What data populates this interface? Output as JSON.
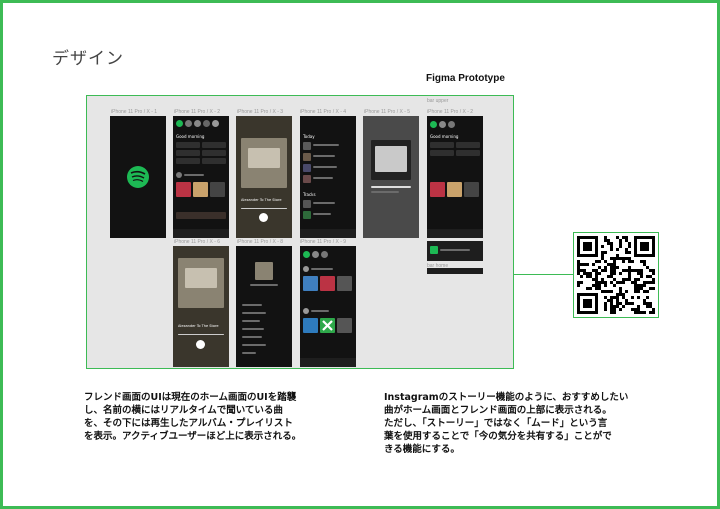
{
  "page": {
    "title": "デザイン",
    "prototype_label": "Figma Prototype",
    "accent_color": "#3dbb55",
    "spotify_green": "#1db954"
  },
  "frames": [
    {
      "label": "iPhone 11 Pro / X - 1"
    },
    {
      "label": "iPhone 11 Pro / X - 2"
    },
    {
      "label": "iPhone 11 Pro / X - 3"
    },
    {
      "label": "iPhone 11 Pro / X - 4"
    },
    {
      "label": "iPhone 11 Pro / X - 5"
    },
    {
      "label": "bar upper"
    },
    {
      "label": "iPhone 11 Pro / X - 6"
    },
    {
      "label": "iPhone 11 Pro / X - 8"
    },
    {
      "label": "iPhone 11 Pro / X - 9"
    },
    {
      "label": "bar home"
    }
  ],
  "phone_text": {
    "good_morning": "Good morning",
    "today": "Today",
    "tracks": "Tracks",
    "now_playing": "Alexander To The Store"
  },
  "qr": {
    "icon": "qr-code-icon"
  },
  "descriptions": {
    "left": "フレンド画面のUIは現在のホーム画面のUIを踏襲\nし、名前の横にはリアルタイムで聞いている曲\nを、その下には再生したアルバム・プレイリスト\nを表示。アクティブユーザーほど上に表示される。",
    "right": "Instagramのストーリー機能のように、おすすめしたい\n曲がホーム画面とフレンド画面の上部に表示される。\nただし、「ストーリー」ではなく「ムード」という言\n葉を使用することで「今の気分を共有する」ことがで\nきる機能にする。"
  }
}
